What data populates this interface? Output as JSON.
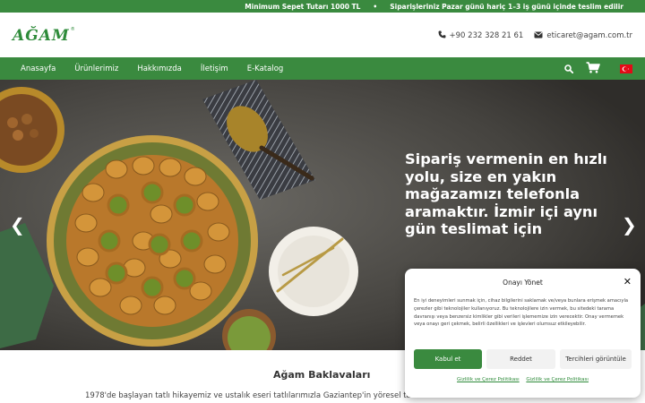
{
  "announcement": {
    "min_order": "Minimum Sepet Tutarı 1000 TL",
    "separator": "•",
    "shipping": "Siparişleriniz Pazar günü hariç 1–3 iş günü içinde teslim edilir"
  },
  "brand": {
    "logo_text": "AĞAM",
    "logo_mark": "®",
    "color": "#2e8b3a"
  },
  "contact": {
    "phone": "+90 232 328 21 61",
    "email": "eticaret@agam.com.tr"
  },
  "nav": {
    "items": [
      "Anasayfa",
      "Ürünlerimiz",
      "Hakkımızda",
      "İletişim",
      "E-Katalog"
    ],
    "background": "#3a8a3f"
  },
  "hero": {
    "headline": "Sipariş vermenin en hızlı yolu, size en yakın mağazamızı telefonla aramaktır. İzmir içi aynı gün teslimat için",
    "prev_arrow": "❮",
    "next_arrow": "❯"
  },
  "about": {
    "title": "Ağam Baklavaları",
    "text": "1978'de başlayan tatlı hikayemiz ve ustalık eseri tatlılarımızla Gaziantep'in yöresel tatlı"
  },
  "consent": {
    "title": "Onayı Yönet",
    "close": "✕",
    "body": "En iyi deneyimleri sunmak için, cihaz bilgilerini saklamak ve/veya bunlara erişmek amacıyla çerezler gibi teknolojiler kullanıyoruz. Bu teknolojilere izin vermek, bu sitedeki tarama davranışı veya benzersiz kimlikler gibi verileri işlememize izin verecektir. Onay vermemek veya onayı geri çekmek, belirli özellikleri ve işlevleri olumsuz etkileyebilir.",
    "accept": "Kabul et",
    "deny": "Reddet",
    "preferences": "Tercihleri görüntüle",
    "link1": "Gizlilik ve Çerez Politikası",
    "link2": "Gizlilik ve Çerez Politikası"
  },
  "icons": [
    "phone-icon",
    "envelope-icon",
    "search-icon",
    "cart-icon",
    "turkey-flag-icon"
  ]
}
